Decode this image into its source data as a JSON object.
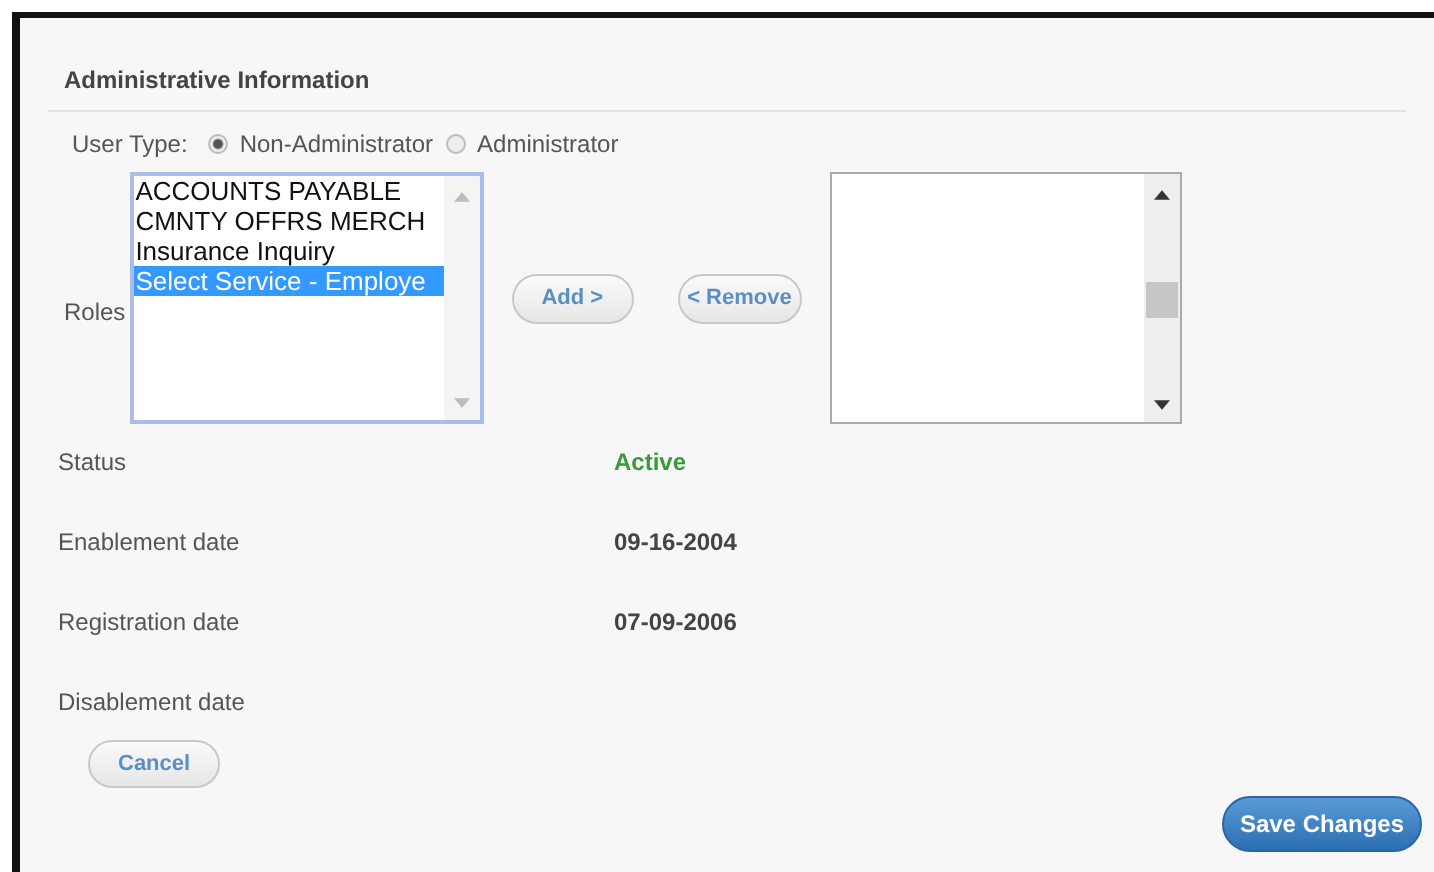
{
  "section": {
    "title": "Administrative Information"
  },
  "user_type": {
    "label": "User Type:",
    "options": [
      {
        "label": "Non-Administrator",
        "selected": true
      },
      {
        "label": "Administrator",
        "selected": false
      }
    ]
  },
  "roles": {
    "label": "Roles",
    "available": [
      {
        "label": "ACCOUNTS PAYABLE",
        "selected": false
      },
      {
        "label": "CMNTY OFFRS MERCH",
        "selected": false
      },
      {
        "label": "Insurance Inquiry",
        "selected": false
      },
      {
        "label": "Select Service - Employe",
        "selected": true
      }
    ],
    "add_button": "Add >",
    "remove_button": "< Remove"
  },
  "details": [
    {
      "kind": "status",
      "label": "Status",
      "value": "Active"
    },
    {
      "kind": "date",
      "label": "Enablement date",
      "value": "09-16-2004"
    },
    {
      "kind": "date",
      "label": "Registration date",
      "value": "07-09-2006"
    },
    {
      "label": "Disablement date"
    }
  ],
  "buttons": {
    "cancel": "Cancel",
    "save": "Save Changes"
  }
}
